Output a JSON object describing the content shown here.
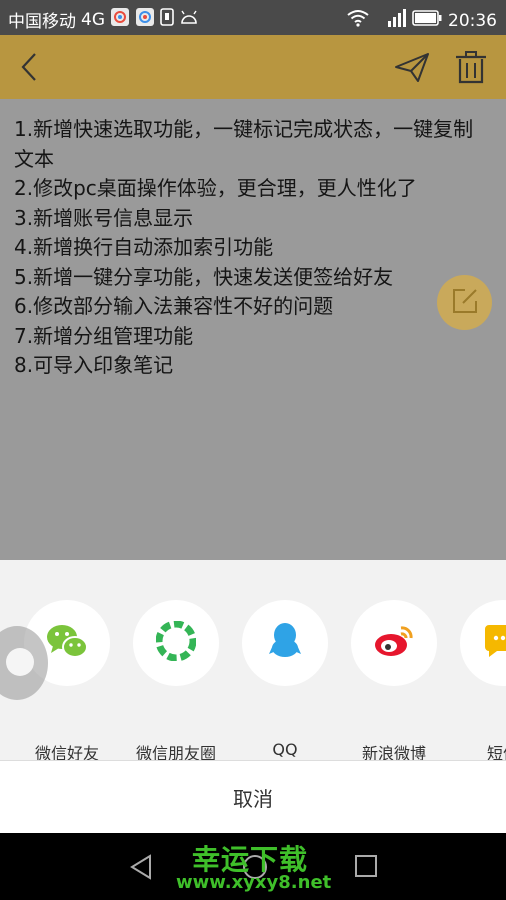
{
  "status_bar": {
    "carrier": "中国移动",
    "network": "4G",
    "signal_network": "4G",
    "time": "20:36",
    "icons": [
      "app-icon-1",
      "app-icon-2",
      "sim-icon",
      "android-icon",
      "wifi-icon",
      "signal-icon",
      "battery-icon"
    ]
  },
  "toolbar": {
    "back_icon": "chevron-left-icon",
    "send_icon": "paper-plane-icon",
    "delete_icon": "trash-icon",
    "accent_color": "#b89640"
  },
  "note": {
    "lines": [
      "1.新增快速选取功能，一键标记完成状态，一键复制文本",
      "2.修改pc桌面操作体验，更合理，更人性化了",
      "3.新增账号信息显示",
      "4.新增换行自动添加索引功能",
      "5.新增一键分享功能，快速发送便签给好友",
      "6.修改部分输入法兼容性不好的问题",
      "7.新增分组管理功能",
      "8.可导入印象笔记"
    ],
    "edit_icon": "edit-icon"
  },
  "share": {
    "items": [
      {
        "label": "微信好友",
        "icon": "wechat-icon",
        "color": "#7bc43b"
      },
      {
        "label": "微信朋友圈",
        "icon": "moments-icon",
        "color": "#34b556"
      },
      {
        "label": "QQ",
        "icon": "qq-icon",
        "color": "#2fa3e6"
      },
      {
        "label": "新浪微博",
        "icon": "weibo-icon",
        "color": "#e6162d"
      },
      {
        "label": "短信",
        "icon": "sms-icon",
        "color": "#f5b800"
      }
    ],
    "cancel_label": "取消"
  },
  "nav": {
    "back_icon": "nav-back-icon",
    "home_icon": "nav-home-icon",
    "recent_icon": "nav-recent-icon"
  },
  "watermark": {
    "title": "幸运下载",
    "url": "www.xyxy8.net"
  }
}
